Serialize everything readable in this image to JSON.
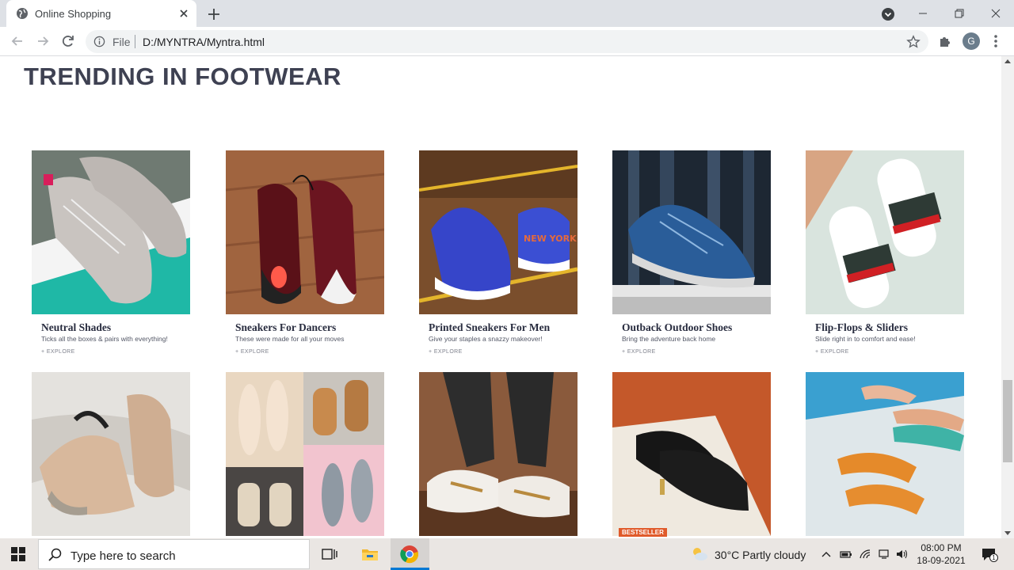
{
  "browser": {
    "tab_title": "Online Shopping",
    "address_scheme": "File",
    "address_url": "D:/MYNTRA/Myntra.html",
    "profile_initial": "G"
  },
  "page": {
    "section_title": "TRENDING IN FOOTWEAR",
    "explore_label": "+ EXPLORE",
    "cards_row1": [
      {
        "name": "Neutral Shades",
        "subtitle": "Ticks all the boxes & pairs with everything!"
      },
      {
        "name": "Sneakers For Dancers",
        "subtitle": "These were made for all your moves"
      },
      {
        "name": "Printed Sneakers For Men",
        "subtitle": "Give your staples a snazzy makeover!"
      },
      {
        "name": "Outback Outdoor Shoes",
        "subtitle": "Bring the adventure back home"
      },
      {
        "name": "Flip-Flops & Sliders",
        "subtitle": "Slide right in to comfort and ease!"
      }
    ],
    "bestseller_badge": "BESTSELLER"
  },
  "taskbar": {
    "search_placeholder": "Type here to search",
    "weather": "30°C  Partly cloudy",
    "time": "08:00 PM",
    "date": "18-09-2021",
    "notification_count": "1"
  }
}
